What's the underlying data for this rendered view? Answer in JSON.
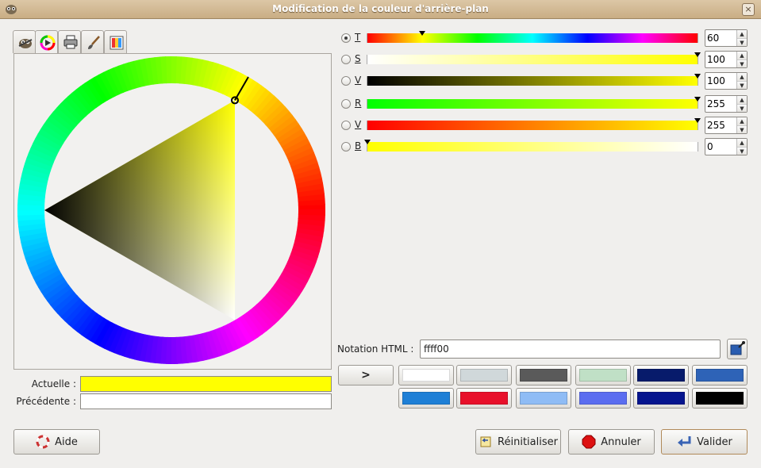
{
  "window": {
    "title": "Modification de la couleur d'arrière-plan",
    "close_glyph": "×"
  },
  "tabs": [
    {
      "icon": "gimp-icon"
    },
    {
      "icon": "color-wheel-icon"
    },
    {
      "icon": "printer-cmyk-icon"
    },
    {
      "icon": "paintbrush-watercolor-icon"
    },
    {
      "icon": "palette-scales-icon"
    }
  ],
  "colors": {
    "current_label": "Actuelle :",
    "current_color": "#ffff00",
    "previous_label": "Précédente :",
    "previous_color": "#ffffff"
  },
  "sliders": [
    {
      "label": "T",
      "value": "60",
      "selected": true,
      "fraction": 0.1667
    },
    {
      "label": "S",
      "value": "100",
      "selected": false,
      "fraction": 1.0
    },
    {
      "label": "V",
      "value": "100",
      "selected": false,
      "fraction": 1.0
    },
    {
      "label": "R",
      "value": "255",
      "selected": false,
      "fraction": 1.0
    },
    {
      "label": "V",
      "value": "255",
      "selected": false,
      "fraction": 1.0
    },
    {
      "label": "B",
      "value": "0",
      "selected": false,
      "fraction": 0.0
    }
  ],
  "html_notation": {
    "label": "Notation HTML :",
    "value": "ffff00"
  },
  "history": {
    "arrow_label": ">",
    "swatches": [
      "#ffffff",
      "#d0d8da",
      "#5a5a5a",
      "#c0e0c6",
      "#071b6b",
      "#2e63b7",
      "#1e7fd6",
      "#e8102a",
      "#8fbcf5",
      "#5b6df0",
      "#06158e",
      "#000000"
    ]
  },
  "buttons": {
    "help": "Aide",
    "reset": "Réinitialiser",
    "cancel": "Annuler",
    "ok": "Valider"
  }
}
